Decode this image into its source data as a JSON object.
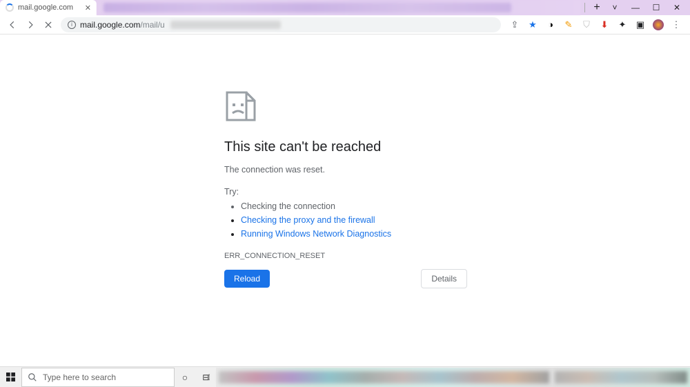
{
  "tab": {
    "title": "mail.google.com",
    "close_glyph": "✕"
  },
  "window_controls": {
    "new_tab": "+",
    "chevron": "˅",
    "minimize": "—",
    "maximize": "☐",
    "close": "✕"
  },
  "toolbar": {
    "url_host": "mail.google.com",
    "url_path": "/mail/u",
    "share_glyph": "⇪",
    "star_glyph": "★"
  },
  "extensions": [
    {
      "name": "ext-blackwhite",
      "glyph": "◑",
      "color": "#000"
    },
    {
      "name": "ext-pencil",
      "glyph": "✎",
      "color": "#f29900"
    },
    {
      "name": "ext-shield",
      "glyph": "⛉",
      "color": "#bdbdbd"
    },
    {
      "name": "ext-download",
      "glyph": "⬇",
      "color": "#d93025"
    },
    {
      "name": "ext-puzzle",
      "glyph": "✦",
      "color": "#202124"
    },
    {
      "name": "ext-reader",
      "glyph": "▣",
      "color": "#202124"
    }
  ],
  "error": {
    "title": "This site can't be reached",
    "subtitle": "The connection was reset.",
    "try_label": "Try:",
    "items": [
      {
        "text": "Checking the connection",
        "link": false
      },
      {
        "text": "Checking the proxy and the firewall",
        "link": true
      },
      {
        "text": "Running Windows Network Diagnostics",
        "link": true
      }
    ],
    "code": "ERR_CONNECTION_RESET",
    "reload_label": "Reload",
    "details_label": "Details"
  },
  "taskbar": {
    "search_placeholder": "Type here to search",
    "cortana_glyph": "○",
    "taskview_glyph": "⊟⁞"
  }
}
